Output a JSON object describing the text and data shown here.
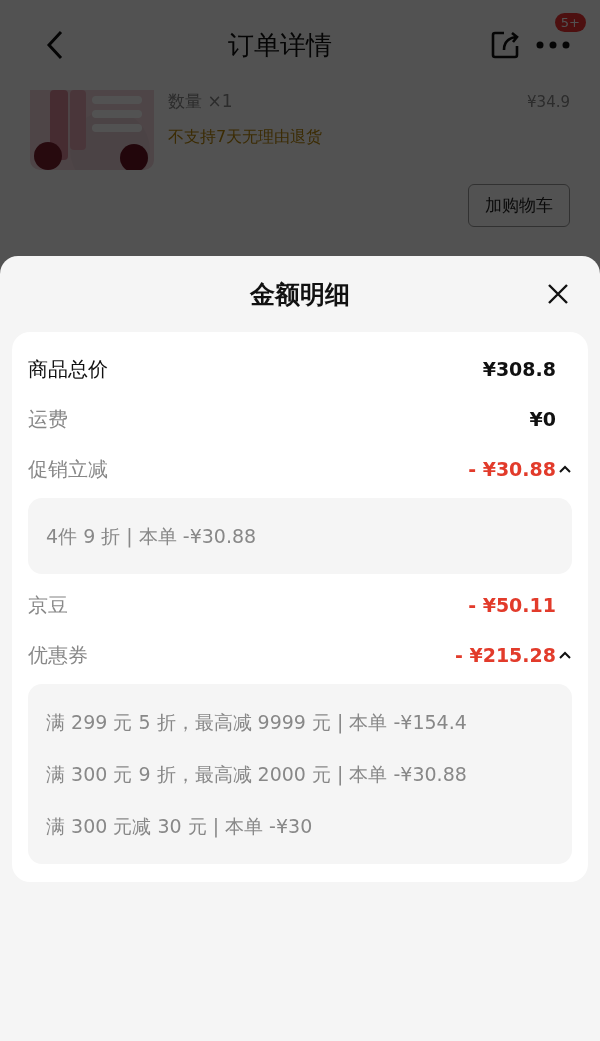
{
  "header": {
    "title": "订单详情",
    "badge": "5+"
  },
  "product": {
    "quantity": "数量 ×1",
    "price": "¥34.9",
    "notice": "不支持7天无理由退货",
    "button": "加购物车"
  },
  "sheet": {
    "title": "金额明细",
    "rows": [
      {
        "kind": "total",
        "label": "商品总价",
        "amount": "¥308.8"
      },
      {
        "kind": "fee",
        "label": "运费",
        "amount": "¥0"
      },
      {
        "kind": "discount",
        "label": "促销立减",
        "amount": "- ¥30.88",
        "expanded": true,
        "details": [
          "4件 9 折 | 本单 -¥30.88"
        ]
      },
      {
        "kind": "discount",
        "label": "京豆",
        "amount": "- ¥50.11"
      },
      {
        "kind": "discount",
        "label": "优惠券",
        "amount": "- ¥215.28",
        "expanded": true,
        "details": [
          "满 299 元 5 折，最高减 9999 元 | 本单 -¥154.4",
          "满 300 元 9 折，最高减 2000 元 | 本单 -¥30.88",
          "满 300 元减 30 元 | 本单 -¥30"
        ]
      }
    ]
  }
}
